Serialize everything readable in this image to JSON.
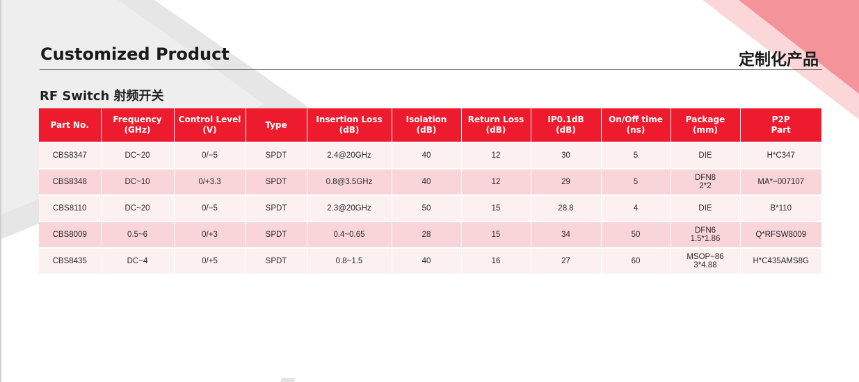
{
  "header": {
    "title": "Customized Product",
    "title_cn": "定制化产品"
  },
  "section": {
    "title": "RF Switch 射频开关"
  },
  "colors": {
    "accent": "#ee1b2e",
    "row_light": "#fdf0f1",
    "row_dark": "#f9d5d9",
    "decor_grey": "#e6e6e7",
    "decor_pink": "#f4949a"
  },
  "table": {
    "columns": [
      [
        "Part No."
      ],
      [
        "Frequency",
        "(GHz)"
      ],
      [
        "Control Level",
        "(V)"
      ],
      [
        "Type"
      ],
      [
        "Insertion Loss",
        "(dB)"
      ],
      [
        "Isolation",
        "(dB)"
      ],
      [
        "Return Loss",
        "(dB)"
      ],
      [
        "IP0.1dB",
        "(dB)"
      ],
      [
        "On/Off time",
        "(ns)"
      ],
      [
        "Package",
        "(mm)"
      ],
      [
        "P2P",
        "Part"
      ]
    ],
    "rows": [
      [
        [
          "CBS8347"
        ],
        [
          "DC~20"
        ],
        [
          "0/−5"
        ],
        [
          "SPDT"
        ],
        [
          "2.4@20GHz"
        ],
        [
          "40"
        ],
        [
          "12"
        ],
        [
          "30"
        ],
        [
          "5"
        ],
        [
          "DIE"
        ],
        [
          "H*C347"
        ]
      ],
      [
        [
          "CBS8348"
        ],
        [
          "DC~10"
        ],
        [
          "0/+3.3"
        ],
        [
          "SPDT"
        ],
        [
          "0.8@3.5GHz"
        ],
        [
          "40"
        ],
        [
          "12"
        ],
        [
          "29"
        ],
        [
          "5"
        ],
        [
          "DFN8",
          "2*2"
        ],
        [
          "MA*−007107"
        ]
      ],
      [
        [
          "CBS8110"
        ],
        [
          "DC~20"
        ],
        [
          "0/−5"
        ],
        [
          "SPDT"
        ],
        [
          "2.3@20GHz"
        ],
        [
          "50"
        ],
        [
          "15"
        ],
        [
          "28.8"
        ],
        [
          "4"
        ],
        [
          "DIE"
        ],
        [
          "B*110"
        ]
      ],
      [
        [
          "CBS8009"
        ],
        [
          "0.5~6"
        ],
        [
          "0/+3"
        ],
        [
          "SPDT"
        ],
        [
          "0.4~0.65"
        ],
        [
          "28"
        ],
        [
          "15"
        ],
        [
          "34"
        ],
        [
          "50"
        ],
        [
          "DFN6",
          "1.5*1.86"
        ],
        [
          "Q*RFSW8009"
        ]
      ],
      [
        [
          "CBS8435"
        ],
        [
          "DC~4"
        ],
        [
          "0/+5"
        ],
        [
          "SPDT"
        ],
        [
          "0.8~1.5"
        ],
        [
          "40"
        ],
        [
          "16"
        ],
        [
          "27"
        ],
        [
          "60"
        ],
        [
          "MSOP−86",
          "3*4.88"
        ],
        [
          "H*C435AMS8G"
        ]
      ]
    ]
  }
}
